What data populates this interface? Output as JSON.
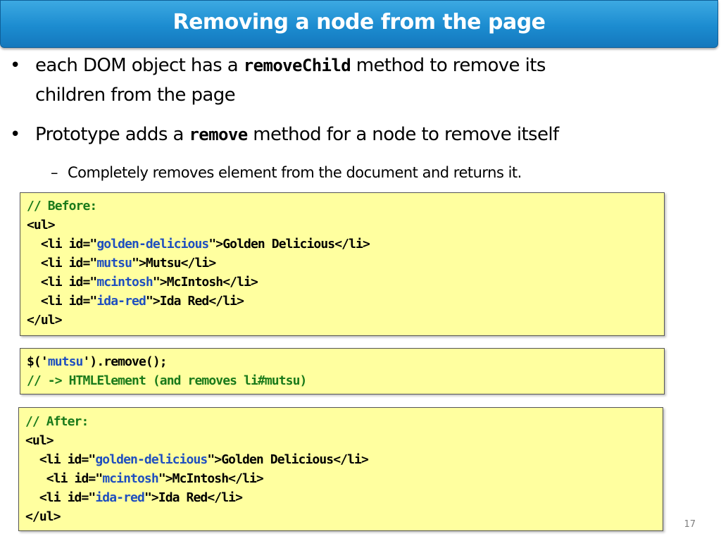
{
  "title": "Removing a node from the page",
  "bullets": {
    "b1": {
      "marker": "•",
      "text_pre": "each DOM object has a ",
      "code": "removeChild",
      "text_post": " method to remove its",
      "line2": "children from the page"
    },
    "b2": {
      "marker": "•",
      "text_pre": "Prototype adds a ",
      "code": "remove",
      "text_post": " method for a node to remove itself"
    },
    "sub": {
      "marker": "–",
      "text": "Completely removes element from the document and returns it."
    }
  },
  "code_before": {
    "comment": "// Before:",
    "ul_open": "<ul>",
    "li1": {
      "pre": "  <li id=\"",
      "id": "golden-delicious",
      "post": "\">Golden Delicious</li>"
    },
    "li2": {
      "pre": "  <li id=\"",
      "id": "mutsu",
      "post": "\">Mutsu</li>"
    },
    "li3": {
      "pre": "  <li id=\"",
      "id": "mcintosh",
      "post": "\">McIntosh</li>"
    },
    "li4": {
      "pre": "  <li id=\"",
      "id": "ida-red",
      "post": "\">Ida Red</li>"
    },
    "ul_close": "</ul>"
  },
  "code_call": {
    "pre": "$('",
    "arg": "mutsu",
    "post": "').remove();",
    "comment": "// -> HTMLElement (and removes li#mutsu)"
  },
  "code_after": {
    "comment": "// After:",
    "ul_open": "<ul>",
    "li1": {
      "pre": "  <li id=\"",
      "id": "golden-delicious",
      "post": "\">Golden Delicious</li>"
    },
    "li2": {
      "pre": "   <li id=\"",
      "id": "mcintosh",
      "post": "\">McIntosh</li>"
    },
    "li3": {
      "pre": "  <li id=\"",
      "id": "ida-red",
      "post": "\">Ida Red</li>"
    },
    "ul_close": "</ul>"
  },
  "page_number": "17",
  "colors": {
    "title_bar": "#1c8cd0",
    "title_text": "#ffffff",
    "code_background": "#ffff9f",
    "comment": "#1a7a1a",
    "string": "#1f4fbf"
  }
}
